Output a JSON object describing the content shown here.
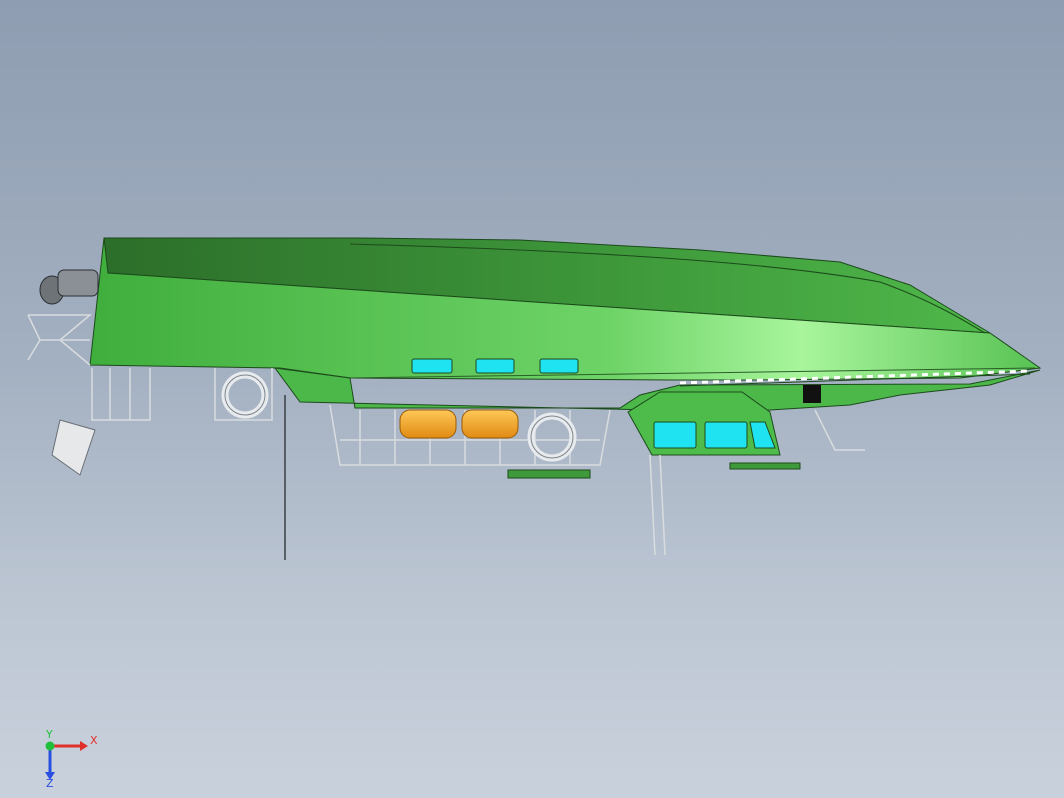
{
  "viewport": {
    "background_top": "#8e9db1",
    "background_bottom": "#c9d1dc"
  },
  "model": {
    "hull_color": "#5cc45a",
    "hull_dark": "#2f7a2e",
    "window_color": "#1fe3f0",
    "liferaft_color": "#f5a623",
    "frame_color": "#d8dcdf"
  },
  "triad": {
    "x_label": "X",
    "y_label": "Y",
    "z_label": "Z",
    "x_color": "#e0302a",
    "y_color": "#1fbf3a",
    "z_color": "#2a4fe0"
  }
}
